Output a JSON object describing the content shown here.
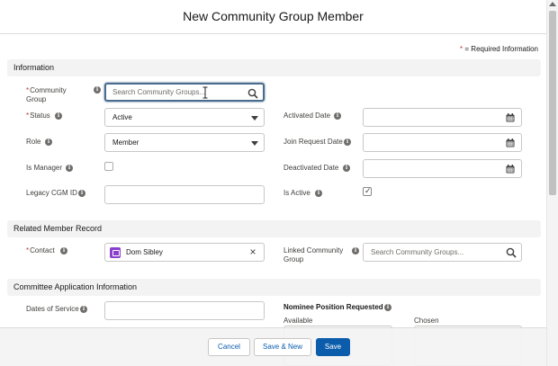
{
  "modal": {
    "title": "New Community Group Member",
    "required_note_star": "*",
    "required_note_text": "= Required Information"
  },
  "sections": {
    "information": "Information",
    "related": "Related Member Record",
    "committee": "Committee Application Information"
  },
  "fields": {
    "community_group": {
      "label_line1": "Community",
      "label_line2": "Group",
      "required": "*",
      "placeholder": "Search Community Groups..."
    },
    "status": {
      "label": "Status",
      "required": "*",
      "value": "Active"
    },
    "role": {
      "label": "Role",
      "value": "Member"
    },
    "is_manager": {
      "label": "Is Manager",
      "checked": false
    },
    "legacy_cgm_id": {
      "label": "Legacy CGM ID",
      "value": ""
    },
    "activated_date": {
      "label": "Activated Date",
      "value": ""
    },
    "join_request_date": {
      "label": "Join Request Date",
      "value": ""
    },
    "deactivated_date": {
      "label": "Deactivated Date",
      "value": ""
    },
    "is_active": {
      "label": "Is Active",
      "checked": true
    },
    "contact": {
      "label": "Contact",
      "required": "*",
      "value": "Dom Sibley"
    },
    "linked_community_group": {
      "label_line1": "Linked Community",
      "label_line2": "Group",
      "placeholder": "Search Community Groups..."
    },
    "dates_of_service": {
      "label": "Dates of Service",
      "value": ""
    },
    "nominee_position": {
      "label": "Nominee Position Requested",
      "available_label": "Available",
      "chosen_label": "Chosen"
    }
  },
  "footer": {
    "cancel": "Cancel",
    "save_new": "Save & New",
    "save": "Save"
  },
  "icons": {
    "info": "i",
    "checkmark": "✓",
    "clear": "×"
  },
  "colors": {
    "brand": "#0b5cab",
    "required": "#c23934",
    "contact_badge": "#8b40cc",
    "focus_border": "#4a6d8f"
  }
}
